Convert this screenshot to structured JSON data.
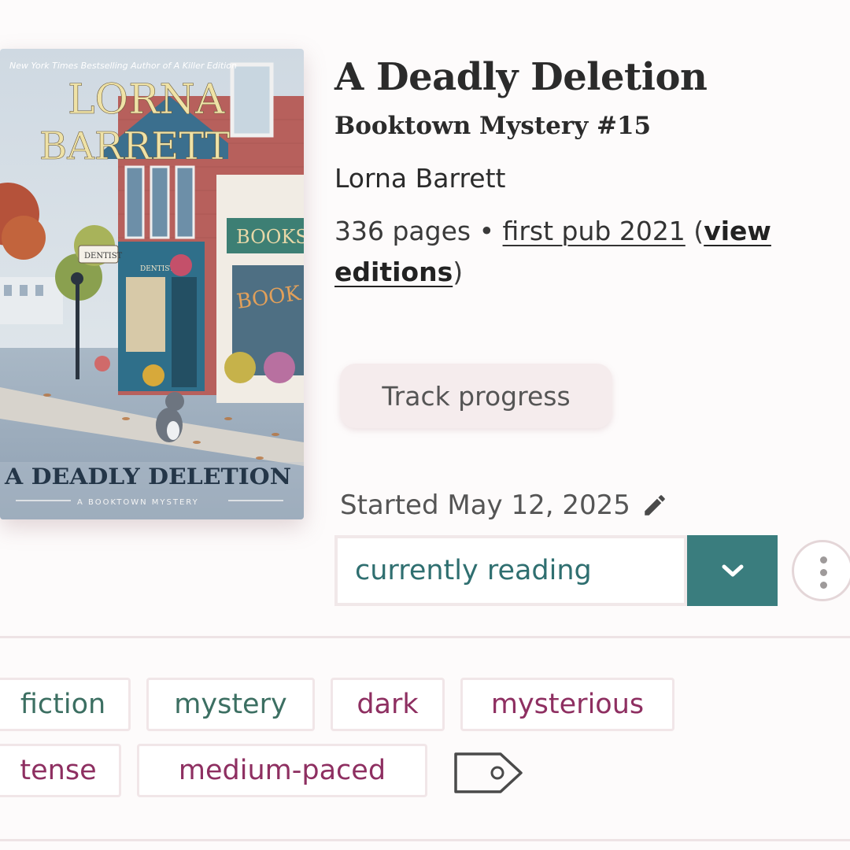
{
  "cover": {
    "tagline": "New York Times Bestselling Author of A Killer Edition",
    "author_line1": "LORNA",
    "author_line2": "BARRETT",
    "title": "A DEADLY DELETION",
    "series": "A BOOKTOWN MYSTERY",
    "sign_dentist": "DENTIST",
    "sign_books": "BOOKS",
    "window_books": "BOOK"
  },
  "book": {
    "title": "A Deadly Deletion",
    "series": "Booktown Mystery #15",
    "author": "Lorna Barrett",
    "pages": "336 pages",
    "separator": " • ",
    "first_pub": "first pub 2021",
    "paren_open": " (",
    "view_editions": "view editions",
    "paren_close": ")"
  },
  "actions": {
    "track_progress": "Track progress",
    "started": "Started May 12, 2025",
    "status": "currently reading"
  },
  "tags": {
    "row1": [
      "fiction",
      "mystery",
      "dark",
      "mysterious"
    ],
    "row2": [
      "tense",
      "medium-paced"
    ]
  },
  "colors": {
    "teal": "#3a7d7e",
    "genre_tag": "#3c6f62",
    "mood_tag": "#8e2f61"
  },
  "icons": [
    "pencil-icon",
    "chevron-down-icon",
    "more-vertical-icon",
    "tag-icon"
  ]
}
